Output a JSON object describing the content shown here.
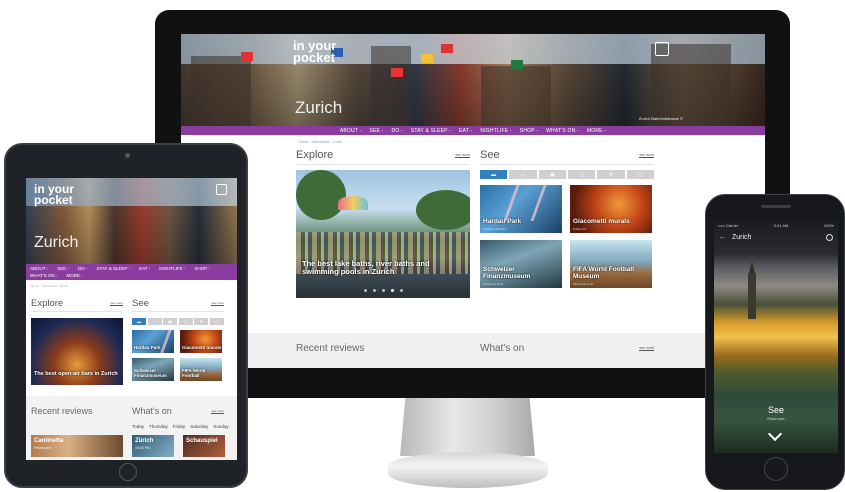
{
  "brand": {
    "logo_line1": "in your",
    "logo_line2": "pocket",
    "city": "Zurich"
  },
  "nav": [
    "ABOUT -",
    "SEE -",
    "DO -",
    "STAY & SLEEP -",
    "EAT -",
    "NIGHTLIFE -",
    "SHOP -",
    "WHAT'S ON -",
    "MORE -"
  ],
  "tablet_nav": [
    "ABOUT -",
    "SEE -",
    "DO -",
    "STAY & SLEEP -",
    "EAT -",
    "NIGHTLIFE -",
    "SHOP -",
    "WHAT'S ON -",
    "MORE -"
  ],
  "breadcrumb": "Home  ·  Switzerland  ·  Zurich",
  "hero_caption": "Zurich Bahnhofstrasse  ©",
  "explore": {
    "title": "Explore",
    "more": "see more",
    "feature_caption": "The best lake baths, river baths and swimming pools in Zurich"
  },
  "see": {
    "title": "See",
    "more": "see more",
    "tabs": [
      "▬",
      "⌂",
      "▣",
      "▢",
      "▼",
      "◻"
    ],
    "tiles": [
      {
        "title": "Hardau Park",
        "sub": "Gardens & Parks"
      },
      {
        "title": "Giacometti murals",
        "sub": "Public Art"
      },
      {
        "title": "Schweizer Finanzmuseum",
        "sub": "Museums & Art"
      },
      {
        "title": "FIFA World Football Museum",
        "sub": "Museums & Art"
      }
    ]
  },
  "reviews": {
    "title": "Recent reviews"
  },
  "whatson": {
    "title": "What's on",
    "more": "see more"
  },
  "tablet": {
    "feature_caption": "The best open-air bars in Zurich",
    "tiles": [
      {
        "title": "Hardau Park"
      },
      {
        "title": "Giacometti murals"
      },
      {
        "title": "Schweizer Finanzmuseum"
      },
      {
        "title": "FIFA World Football"
      }
    ],
    "days": [
      "Today",
      "Thursday",
      "Friday",
      "Saturday",
      "Sunday"
    ],
    "review_item": {
      "title": "Cantinetta",
      "sub": "Restaurant"
    },
    "event_item1": {
      "title": "Zürich",
      "sub": "18:00 PM"
    },
    "event_item2": {
      "title": "Schauspiel",
      "sub": ""
    }
  },
  "phone": {
    "status_left": "••••• Carrier",
    "status_time": "9:41 AM",
    "status_right": "100%",
    "back": "←",
    "city": "Zurich",
    "section": "See",
    "section_sub": "Read more"
  }
}
